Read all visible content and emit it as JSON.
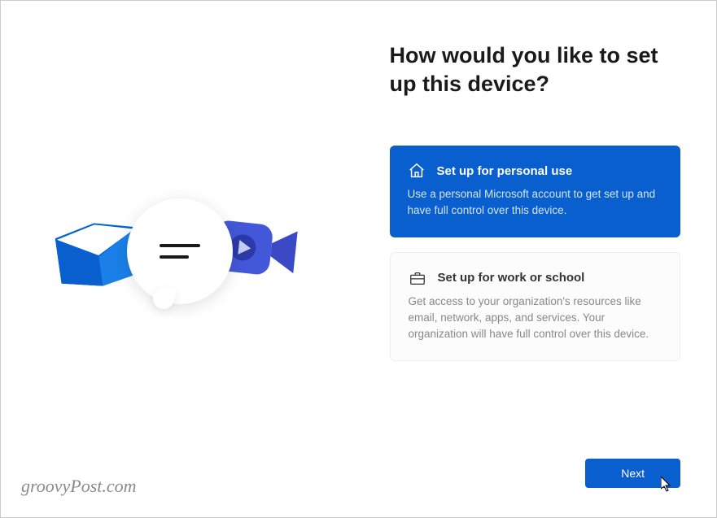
{
  "page_title": "How would you like to set up this device?",
  "options": [
    {
      "title": "Set up for personal use",
      "description": "Use a personal Microsoft account to get set up and have full control over this device.",
      "icon": "home-icon",
      "selected": true
    },
    {
      "title": "Set up for work or school",
      "description": "Get access to your organization's resources like email, network, apps, and services. Your organization will have full control over this device.",
      "icon": "briefcase-icon",
      "selected": false
    }
  ],
  "next_button_label": "Next",
  "watermark": "groovyPost.com",
  "colors": {
    "accent": "#0a5fcf"
  }
}
